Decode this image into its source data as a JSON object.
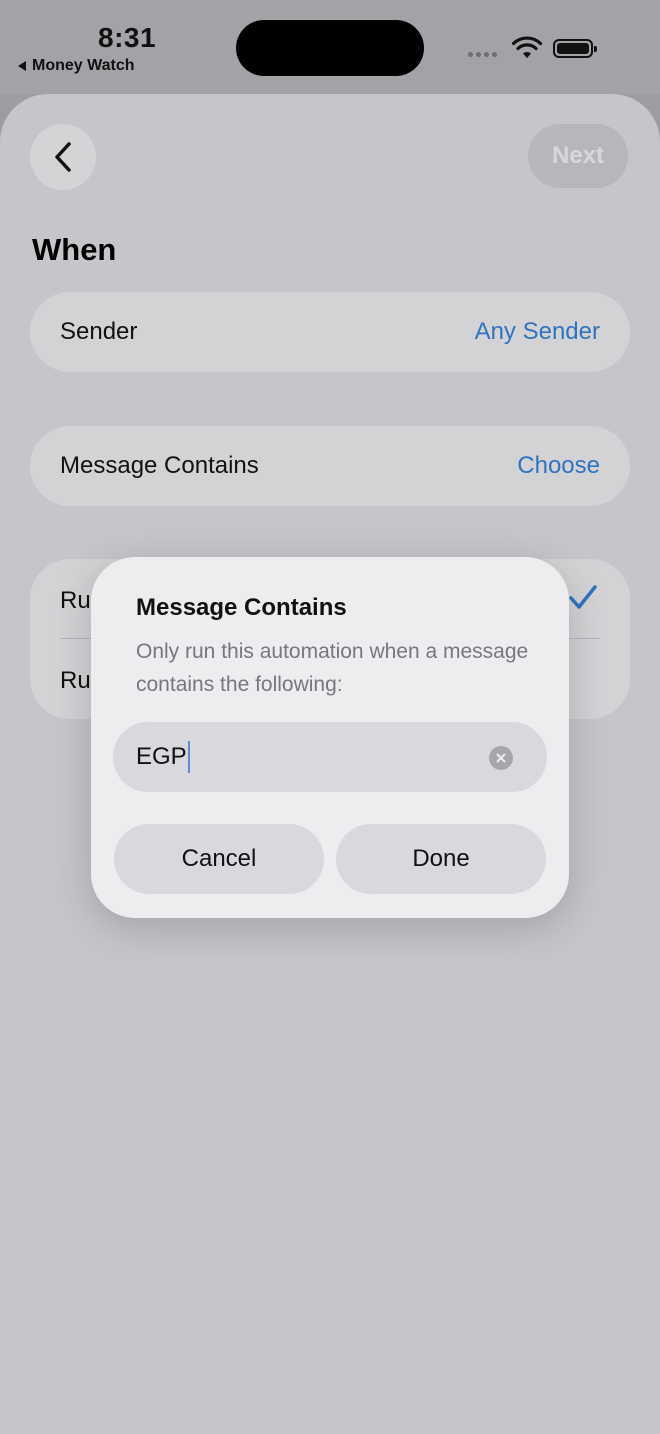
{
  "status_bar": {
    "time": "8:31",
    "back_app": "Money Watch"
  },
  "nav": {
    "next_label": "Next"
  },
  "section": {
    "title": "When"
  },
  "rows": {
    "sender": {
      "label": "Sender",
      "value": "Any Sender"
    },
    "contains": {
      "label": "Message Contains",
      "value": "Choose"
    }
  },
  "run_options": {
    "item1": "Ru",
    "item2": "Ru"
  },
  "dialog": {
    "title": "Message Contains",
    "message": "Only run this automation when a message contains the following:",
    "input_value": "EGP",
    "cancel_label": "Cancel",
    "done_label": "Done"
  },
  "colors": {
    "accent": "#2f74c0",
    "sheet_bg": "#c6c6ca",
    "dialog_bg": "#ededf0"
  }
}
